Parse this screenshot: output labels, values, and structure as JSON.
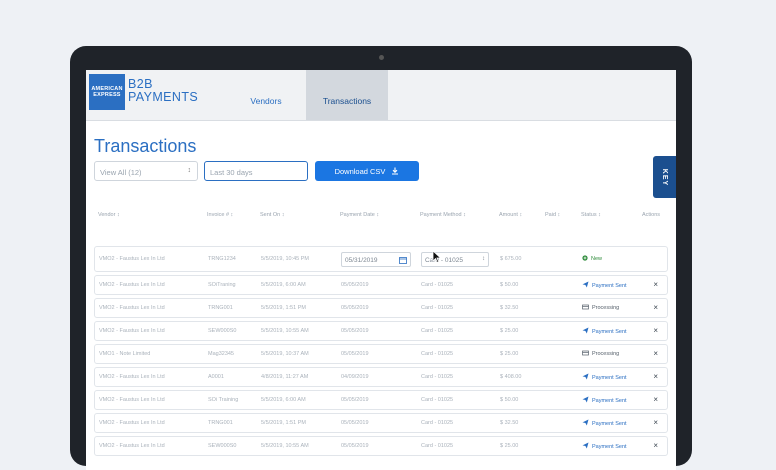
{
  "header": {
    "logo_lines": [
      "AMERICAN",
      "EXPRESS"
    ],
    "brand_line1": "B2B",
    "brand_line2": "PAYMENTS",
    "tabs": [
      {
        "label": "Vendors"
      },
      {
        "label": "Transactions"
      }
    ]
  },
  "page": {
    "title": "Transactions",
    "view_select_value": "View All (12)",
    "date_input_placeholder": "Last 30 days",
    "download_label": "Download CSV",
    "key_tab_label": "KEY"
  },
  "table": {
    "columns": [
      "Vendor",
      "Invoice #",
      "Sent On",
      "Payment Date",
      "Payment Method",
      "Amount",
      "Paid",
      "Status",
      "Actions"
    ],
    "rows": [
      {
        "vendor": "VMO2 - Faustus Lex In Ltd",
        "invoice": "TRNG1234",
        "sent": "5/5/2019, 10:45 PM",
        "pay_date": "05/31/2019",
        "method": "Card - 01025",
        "amount": "$ 675.00",
        "status": "New"
      },
      {
        "vendor": "VMO2 - Faustus Lex In Ltd",
        "invoice": "SOiTraning",
        "sent": "5/5/2019, 6:00 AM",
        "pay_date": "05/05/2019",
        "method": "Card - 01025",
        "amount": "$ 50.00",
        "status": "Payment Sent"
      },
      {
        "vendor": "VMO2 - Faustus Lex In Ltd",
        "invoice": "TRNG001",
        "sent": "5/5/2019, 1:51 PM",
        "pay_date": "05/05/2019",
        "method": "Card - 01025",
        "amount": "$ 32.50",
        "status": "Processing"
      },
      {
        "vendor": "VMO2 - Faustus Lex In Ltd",
        "invoice": "SEW000S0",
        "sent": "5/5/2019, 10:55 AM",
        "pay_date": "05/05/2019",
        "method": "Card - 01025",
        "amount": "$ 25.00",
        "status": "Payment Sent"
      },
      {
        "vendor": "VMO1 - Note Limited",
        "invoice": "Mag32345",
        "sent": "5/5/2019, 10:37 AM",
        "pay_date": "05/05/2019",
        "method": "Card - 01025",
        "amount": "$ 25.00",
        "status": "Processing"
      },
      {
        "vendor": "VMO2 - Faustus Lex In Ltd",
        "invoice": "A0001",
        "sent": "4/8/2019, 11:27 AM",
        "pay_date": "04/09/2019",
        "method": "Card - 01025",
        "amount": "$ 408.00",
        "status": "Payment Sent"
      },
      {
        "vendor": "VMO2 - Faustus Lex In Ltd",
        "invoice": "SOi Training",
        "sent": "5/5/2019, 6:00 AM",
        "pay_date": "05/05/2019",
        "method": "Card - 01025",
        "amount": "$ 50.00",
        "status": "Payment Sent"
      },
      {
        "vendor": "VMO2 - Faustus Lex In Ltd",
        "invoice": "TRNG001",
        "sent": "5/5/2019, 1:51 PM",
        "pay_date": "05/05/2019",
        "method": "Card - 01025",
        "amount": "$ 32.50",
        "status": "Payment Sent"
      },
      {
        "vendor": "VMO2 - Faustus Lex In Ltd",
        "invoice": "SEW000S0",
        "sent": "5/5/2019, 10:55 AM",
        "pay_date": "05/05/2019",
        "method": "Card - 01025",
        "amount": "$ 25.00",
        "status": "Payment Sent"
      }
    ]
  },
  "colors": {
    "accent": "#2b6fc2",
    "button": "#1b76e2",
    "key_tab": "#1b4f8f",
    "status_new": "#2e8b3a"
  },
  "icons": {
    "download": "download-icon",
    "calendar": "calendar-icon",
    "plane": "paper-plane-icon",
    "processing": "processing-icon",
    "new": "plus-circle-icon",
    "close": "close-icon"
  }
}
